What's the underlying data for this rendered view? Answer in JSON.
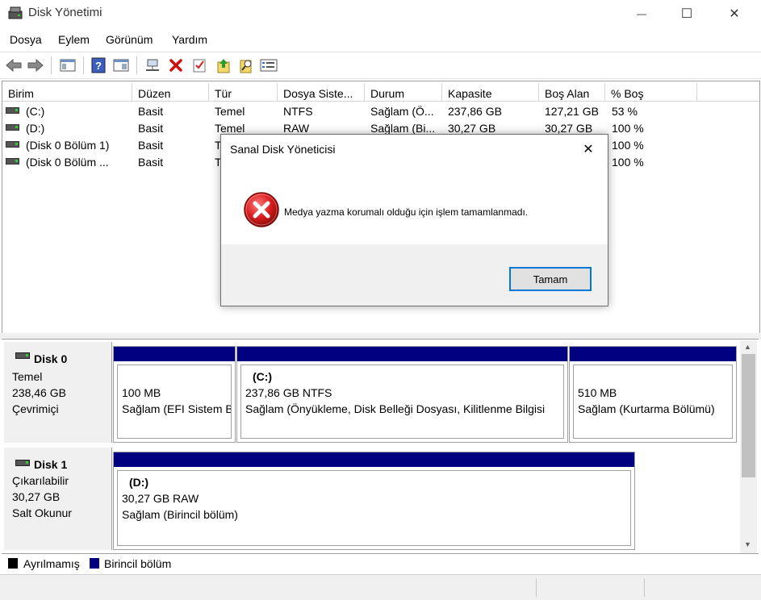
{
  "window": {
    "title": "Disk Yönetimi",
    "minimize_glyph": "—",
    "maximize_glyph": "☐",
    "close_glyph": "✕"
  },
  "menu": [
    "Dosya",
    "Eylem",
    "Görünüm",
    "Yardım"
  ],
  "toolbar": {
    "icons": [
      "back-arrow-icon",
      "forward-arrow-icon",
      "console-tree-icon",
      "help-icon",
      "properties-icon",
      "connect-icon",
      "delete-icon",
      "check-icon",
      "export-icon",
      "search-icon",
      "list-icon"
    ]
  },
  "volumes": {
    "columns": [
      "Birim",
      "Düzen",
      "Tür",
      "Dosya Siste...",
      "Durum",
      "Kapasite",
      "Boş Alan",
      "% Boş"
    ],
    "rows": [
      [
        "(C:)",
        "Basit",
        "Temel",
        "NTFS",
        "Sağlam (Ö...",
        "237,86 GB",
        "127,21 GB",
        "53 %"
      ],
      [
        "(D:)",
        "Basit",
        "Temel",
        "RAW",
        "Sağlam (Bi...",
        "30,27 GB",
        "30,27 GB",
        "100 %"
      ],
      [
        "(Disk 0 Bölüm 1)",
        "Basit",
        "T",
        "",
        "",
        "",
        "",
        "100 %"
      ],
      [
        "(Disk 0 Bölüm ...",
        "Basit",
        "T",
        "",
        "",
        "",
        "",
        "100 %"
      ]
    ]
  },
  "disks": [
    {
      "name": "Disk 0",
      "type": "Temel",
      "size": "238,46 GB",
      "status": "Çevrimiçi",
      "partitions": [
        {
          "label": "",
          "size": "100 MB",
          "status": "Sağlam (EFI Sistem Bölümü)"
        },
        {
          "label": "(C:)",
          "size": "237,86 GB NTFS",
          "status": "Sağlam (Önyükleme, Disk Belleği Dosyası, Kilitlenme Bilgisi"
        },
        {
          "label": "",
          "size": "510 MB",
          "status": "Sağlam (Kurtarma Bölümü)"
        }
      ]
    },
    {
      "name": "Disk 1",
      "type": "Çıkarılabilir",
      "size": "30,27 GB",
      "status": "Salt Okunur",
      "partitions": [
        {
          "label": "(D:)",
          "size": "30,27 GB RAW",
          "status": "Sağlam (Birincil bölüm)"
        }
      ]
    }
  ],
  "legend": {
    "unallocated": "Ayrılmamış",
    "primary": "Birincil bölüm",
    "unallocated_color": "#000000",
    "primary_color": "#000080"
  },
  "dialog": {
    "title": "Sanal Disk Yöneticisi",
    "close_glyph": "✕",
    "message": "Medya yazma korumalı olduğu için işlem tamamlanmadı.",
    "ok_label": "Tamam"
  },
  "scrollbar": {
    "up": "▲",
    "down": "▼"
  }
}
